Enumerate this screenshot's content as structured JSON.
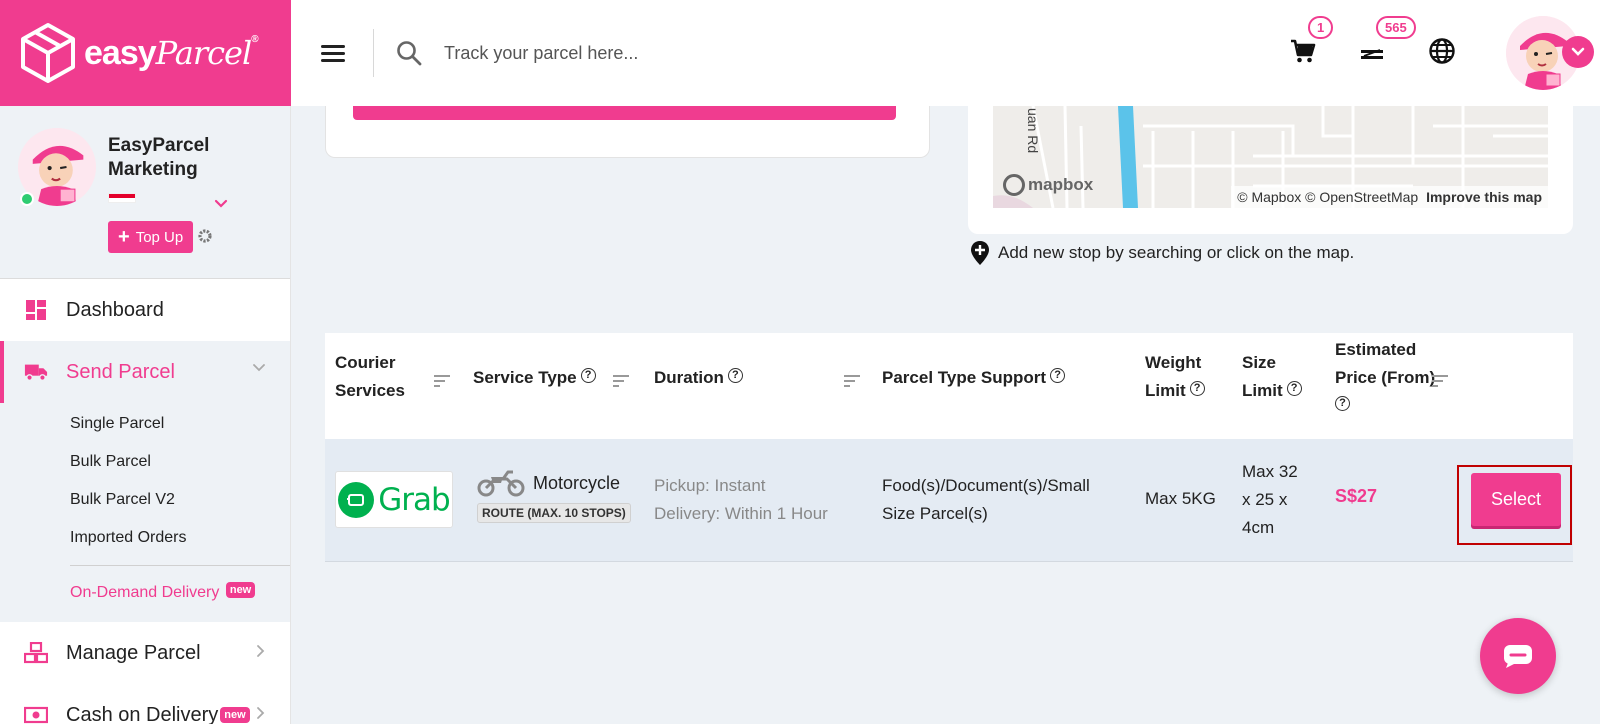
{
  "brand": {
    "name_bold": "easy",
    "name_script": "Parcel",
    "reg": "®"
  },
  "header": {
    "search_placeholder": "Track your parcel here...",
    "cart_count": "1",
    "credit_count": "565"
  },
  "profile": {
    "name": "EasyParcel Marketing",
    "topup_label": "Top Up"
  },
  "nav": {
    "dashboard": "Dashboard",
    "send_parcel": "Send Parcel",
    "send_sub": [
      "Single Parcel",
      "Bulk Parcel",
      "Bulk Parcel V2",
      "Imported Orders"
    ],
    "on_demand": "On-Demand Delivery",
    "new_badge": "new",
    "manage_parcel": "Manage Parcel",
    "cod": "Cash on Delivery"
  },
  "map": {
    "road_label": "uan Rd",
    "logo": "mapbox",
    "attribution": "© Mapbox © OpenStreetMap",
    "improve": "Improve this map"
  },
  "stop_hint": "Add new stop by searching or click on the map.",
  "table": {
    "headers": {
      "courier_1": "Courier",
      "courier_2": "Services",
      "service_type": "Service Type",
      "duration": "Duration",
      "parcel_type": "Parcel Type Support",
      "weight_1": "Weight",
      "weight_2": "Limit",
      "size_1": "Size",
      "size_2": "Limit",
      "price_1": "Estimated",
      "price_2": "Price (From)",
      "help": "?"
    },
    "row": {
      "courier": "Grab",
      "vehicle": "Motorcycle",
      "route_tag": "ROUTE (MAX. 10 STOPS)",
      "pickup": "Pickup: Instant",
      "delivery": "Delivery: Within 1 Hour",
      "parcel_1": "Food(s)/Document(s)/Small",
      "parcel_2": "Size Parcel(s)",
      "weight": "Max 5KG",
      "size_1": "Max 32",
      "size_2": "x 25 x",
      "size_3": "4cm",
      "price": "S$27",
      "select_label": "Select"
    }
  },
  "colors": {
    "brand_pink": "#f03c8f",
    "grab_green": "#00b14f",
    "highlight_red": "#c00000"
  }
}
